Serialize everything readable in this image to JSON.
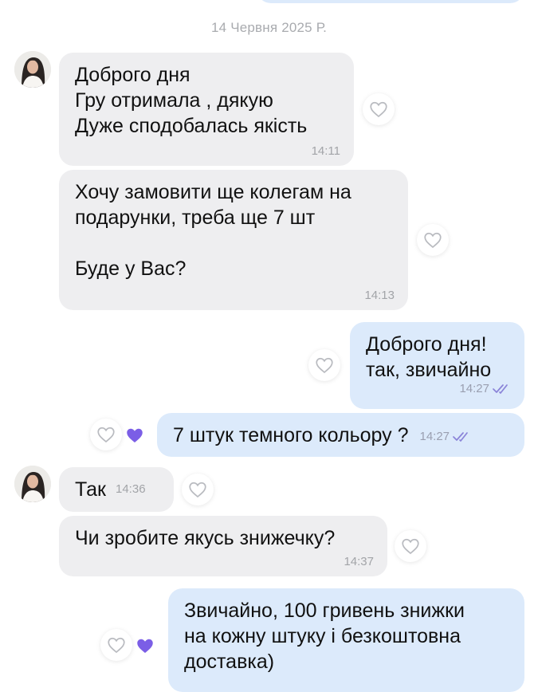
{
  "date_separator": "14 Червня 2025 Р.",
  "colors": {
    "incoming_bubble": "#eeeef0",
    "outgoing_bubble": "#dceafb",
    "heart_filled": "#7b5ee6",
    "read_ticks": "#8a83d8"
  },
  "messages": [
    {
      "direction": "incoming",
      "text": "Доброго дня\nГру отримала , дякую\nДуже сподобалась якість",
      "time": "14:11"
    },
    {
      "direction": "incoming",
      "text": "Хочу замовити ще колегам на\nподарунки, треба ще 7 шт\n\nБуде у Вас?",
      "time": "14:13"
    },
    {
      "direction": "outgoing",
      "text": "Доброго дня!\nтак, звичайно",
      "time": "14:27",
      "status": "read"
    },
    {
      "direction": "outgoing",
      "text": "7 штук темного кольору ?",
      "time": "14:27",
      "status": "read",
      "liked": true
    },
    {
      "direction": "incoming",
      "text": "Так",
      "time": "14:36"
    },
    {
      "direction": "incoming",
      "text": "Чи зробите якусь знижечку?",
      "time": "14:37"
    },
    {
      "direction": "outgoing",
      "text": "Звичайно, 100 гривень знижки\nна кожну штуку і безкоштовна\nдоставка)",
      "liked": true
    }
  ]
}
